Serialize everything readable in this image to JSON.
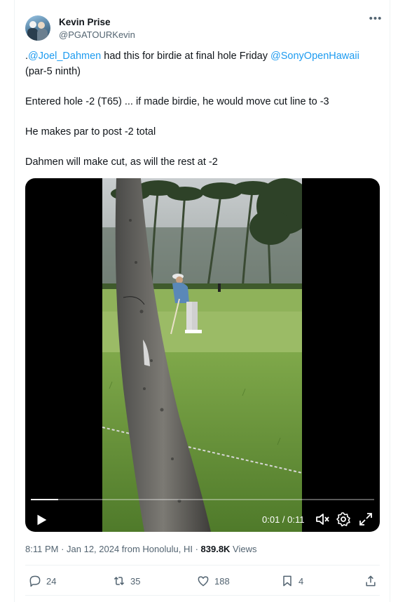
{
  "author": {
    "name": "Kevin Prise",
    "handle": "@PGATOURKevin"
  },
  "more_icon": "more-horizontal-icon",
  "tweet": {
    "line1_prefix": ".",
    "line1_mention1": "@Joel_Dahmen",
    "line1_middle": " had this for birdie at final hole Friday ",
    "line1_mention2": "@SonyOpenHawaii",
    "line2": "(par-5 ninth)",
    "para2": "Entered hole -2 (T65) ... if made birdie, he would move cut line to -3",
    "para3": "He makes par to post -2 total",
    "para4": "Dahmen will make cut, as will the rest at -2"
  },
  "video": {
    "time": "0:01 / 0:11",
    "progress_fraction": 0.08,
    "icons": [
      "play-icon",
      "volume-icon",
      "settings-icon",
      "fullscreen-icon"
    ]
  },
  "meta": {
    "time": "8:11 PM",
    "sep1": " · ",
    "date": "Jan 12, 2024 from Honolulu, HI",
    "sep2": " · ",
    "views_count": "839.8K",
    "views_label": " Views"
  },
  "actions": {
    "replies": "24",
    "reposts": "35",
    "likes": "188",
    "bookmarks": "4"
  },
  "colors": {
    "link": "#1d9bf0",
    "secondary_text": "#536471",
    "primary_text": "#0f1419"
  }
}
